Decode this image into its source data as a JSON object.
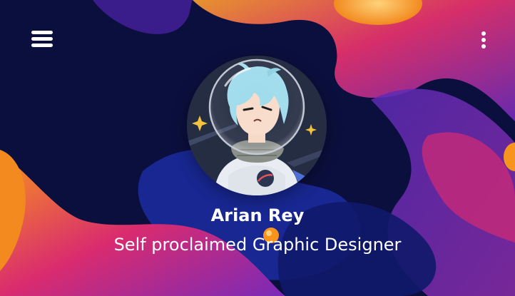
{
  "profile": {
    "name": "Arian Rey",
    "tagline": "Self proclaimed Graphic Designer"
  },
  "icons": {
    "menu": "hamburger-menu-icon",
    "more": "kebab-menu-icon"
  },
  "colors": {
    "background": "#0a0f3a",
    "text": "#ffffff",
    "accent_orange": "#f7941d",
    "accent_pink": "#e0296f",
    "accent_purple": "#6a2bb8"
  }
}
